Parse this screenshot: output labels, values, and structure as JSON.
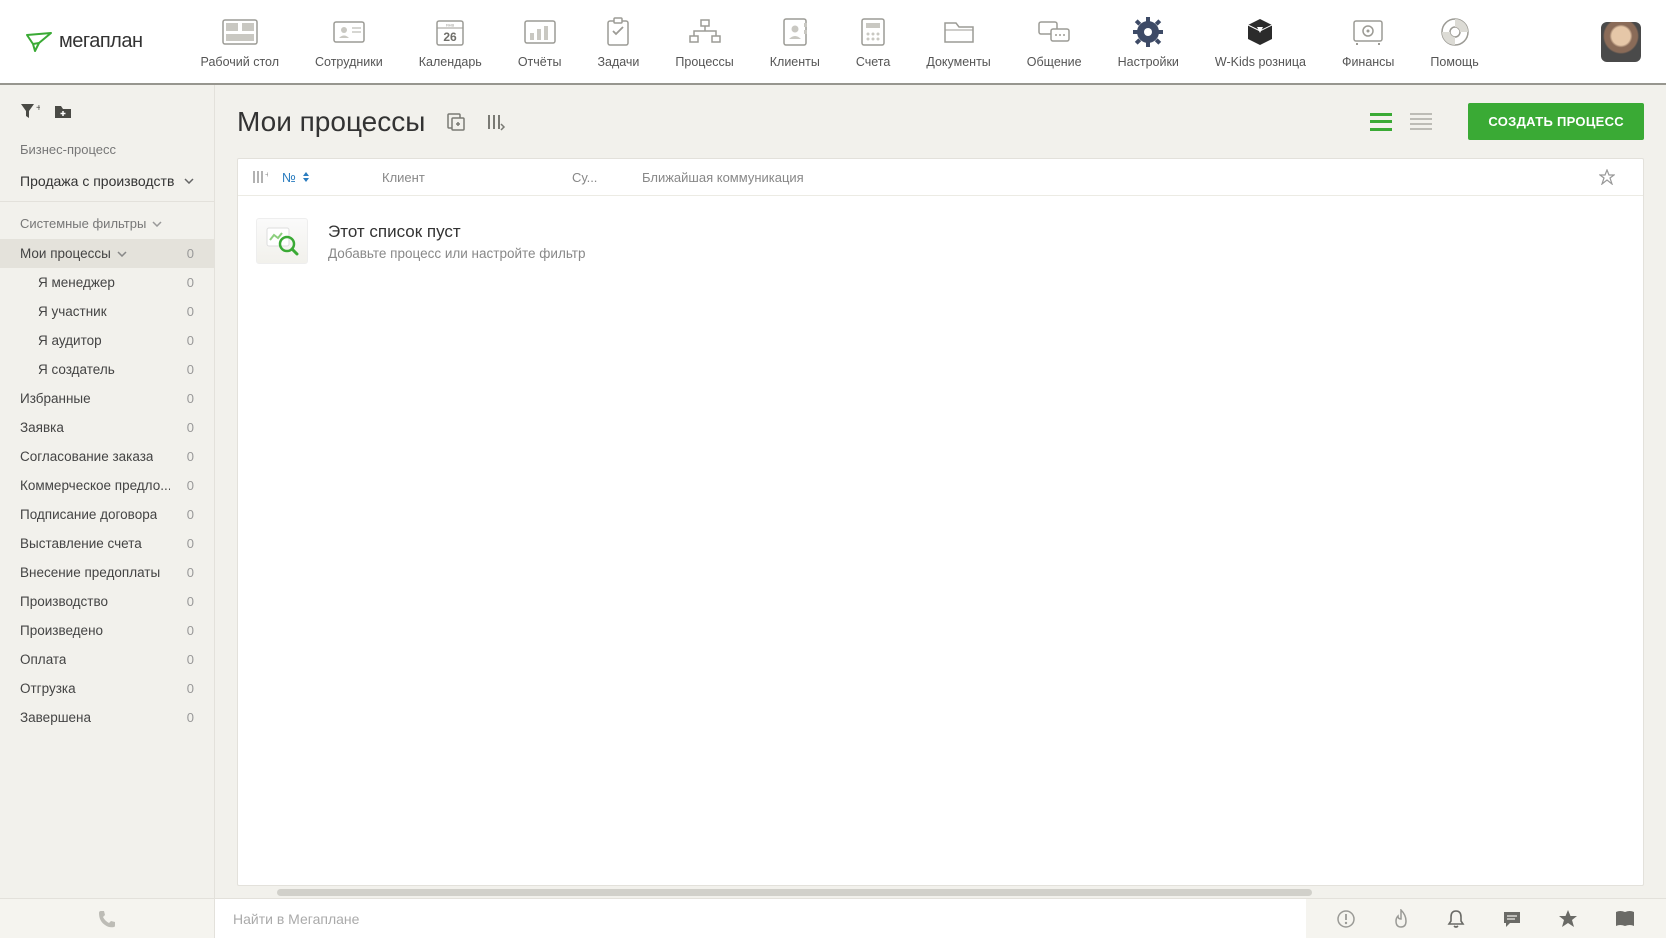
{
  "brand": {
    "name": "мегаплан"
  },
  "nav": {
    "items": [
      {
        "key": "desktop",
        "label": "Рабочий стол"
      },
      {
        "key": "employees",
        "label": "Сотрудники"
      },
      {
        "key": "calendar",
        "label": "Календарь",
        "day_label": "ЯНВ",
        "day_num": "26"
      },
      {
        "key": "reports",
        "label": "Отчёты"
      },
      {
        "key": "tasks",
        "label": "Задачи"
      },
      {
        "key": "processes",
        "label": "Процессы"
      },
      {
        "key": "clients",
        "label": "Клиенты"
      },
      {
        "key": "bills",
        "label": "Счета"
      },
      {
        "key": "documents",
        "label": "Документы"
      },
      {
        "key": "chat",
        "label": "Общение"
      },
      {
        "key": "settings",
        "label": "Настройки"
      },
      {
        "key": "wkids",
        "label": "W-Kids розница"
      },
      {
        "key": "finance",
        "label": "Финансы"
      },
      {
        "key": "help",
        "label": "Помощь"
      }
    ]
  },
  "sidebar": {
    "label": "Бизнес-процесс",
    "select_value": "Продажа с производств",
    "section_title": "Системные фильтры",
    "filters": [
      {
        "label": "Мои процессы",
        "count": "0",
        "active": true,
        "chevron": true
      },
      {
        "label": "Я менеджер",
        "count": "0",
        "sub": true
      },
      {
        "label": "Я участник",
        "count": "0",
        "sub": true
      },
      {
        "label": "Я аудитор",
        "count": "0",
        "sub": true
      },
      {
        "label": "Я создатель",
        "count": "0",
        "sub": true
      },
      {
        "label": "Избранные",
        "count": "0"
      },
      {
        "label": "Заявка",
        "count": "0"
      },
      {
        "label": "Согласование заказа",
        "count": "0"
      },
      {
        "label": "Коммерческое предло...",
        "count": "0"
      },
      {
        "label": "Подписание договора",
        "count": "0"
      },
      {
        "label": "Выставление счета",
        "count": "0"
      },
      {
        "label": "Внесение предоплаты",
        "count": "0"
      },
      {
        "label": "Производство",
        "count": "0"
      },
      {
        "label": "Произведено",
        "count": "0"
      },
      {
        "label": "Оплата",
        "count": "0"
      },
      {
        "label": "Отгрузка",
        "count": "0"
      },
      {
        "label": "Завершена",
        "count": "0"
      }
    ]
  },
  "page": {
    "title": "Мои процессы",
    "create_button": "СОЗДАТЬ ПРОЦЕСС"
  },
  "table": {
    "cols": {
      "num": "№",
      "client": "Клиент",
      "sum": "Су...",
      "comm": "Ближайшая коммуникация"
    },
    "empty_title": "Этот список пуст",
    "empty_sub": "Добавьте процесс или настройте фильтр"
  },
  "search": {
    "placeholder": "Найти в Мегаплане"
  }
}
